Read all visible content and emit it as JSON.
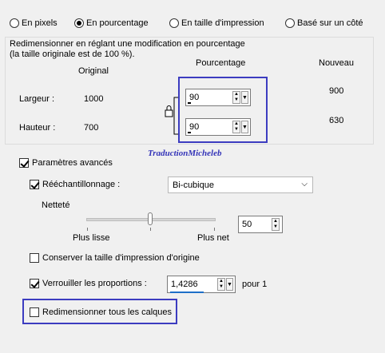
{
  "modes": {
    "pixels": "En pixels",
    "percentage": "En pourcentage",
    "print_size": "En taille d'impression",
    "one_side": "Basé sur un côté"
  },
  "group": {
    "line1": "Redimensionner en réglant une modification en pourcentage",
    "line2": "(la taille originale est de 100 %).",
    "col_original": "Original",
    "col_percentage": "Pourcentage",
    "col_new": "Nouveau",
    "width_label": "Largeur :",
    "height_label": "Hauteur :",
    "width_original": "1000",
    "height_original": "700",
    "width_percent": "90",
    "height_percent": "90",
    "width_new": "900",
    "height_new": "630"
  },
  "watermark": "TraductionMicheleb",
  "advanced": {
    "label": "Paramètres avancés",
    "resample_label": "Rééchantillonnage :",
    "resample_value": "Bi-cubique",
    "sharpness_label": "Netteté",
    "slider_min_label": "Plus lisse",
    "slider_max_label": "Plus net",
    "sharpness_value": "50",
    "sharpness_level": 0.5,
    "keep_print_size": "Conserver la taille d'impression d'origine",
    "lock_ratio": "Verrouiller les proportions :",
    "ratio_value": "1,4286",
    "ratio_suffix": "pour 1",
    "resize_all_layers": "Redimensionner tous les calques"
  },
  "colors": {
    "highlight": "#3c3cc0",
    "watermark": "#3434b8",
    "ratio_underline": "#1e6fc8"
  }
}
